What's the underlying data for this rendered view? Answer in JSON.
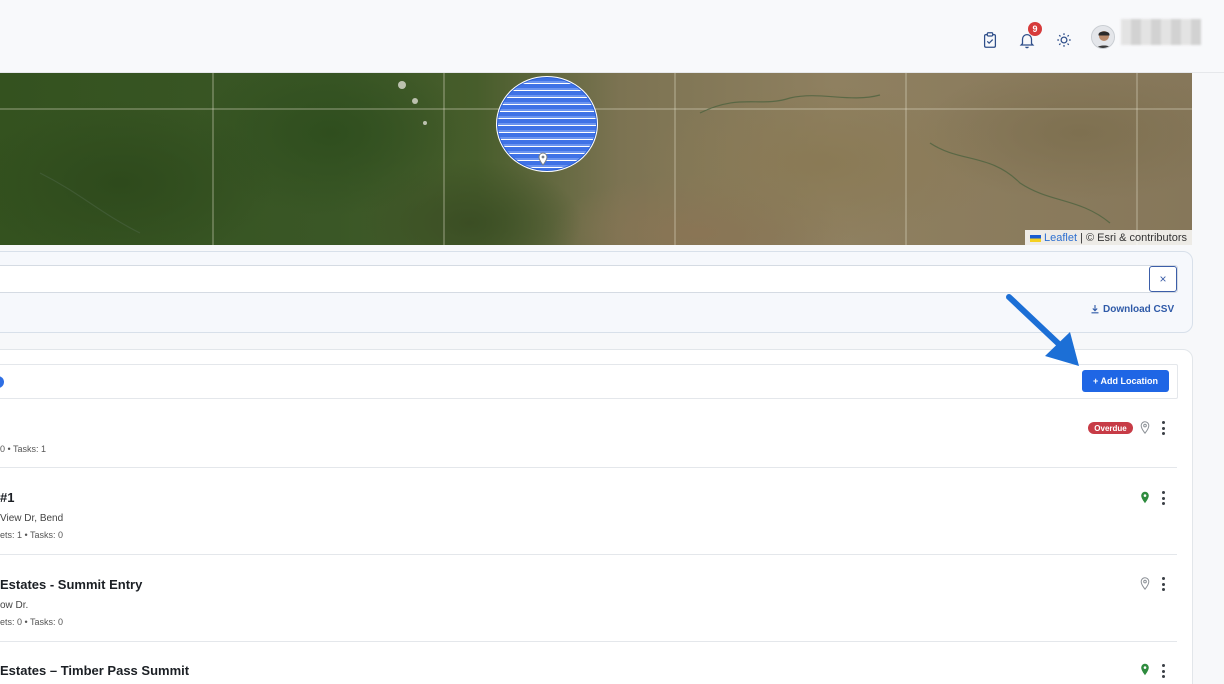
{
  "header": {
    "notification_count": "9",
    "icons": [
      "clipboard-check-icon",
      "bell-icon",
      "sun-icon"
    ]
  },
  "map": {
    "attribution_link": "Leaflet",
    "attribution_text": "| © Esri & contributors"
  },
  "filters": {
    "search_value": "",
    "clear_label": "×",
    "download_label": "Download CSV"
  },
  "locations": {
    "add_button_label": "+ Add Location",
    "rows": [
      {
        "title": "",
        "address": "",
        "meta": "0 • Tasks: 1",
        "status": "Overdue",
        "pin_color": "#8a8f95"
      },
      {
        "title": "#1",
        "address": "View Dr, Bend",
        "meta": "ets: 1 • Tasks: 0",
        "status": "",
        "pin_color": "#2e8b3e"
      },
      {
        "title": "Estates - Summit Entry",
        "address": "ow Dr.",
        "meta": "ets: 0 • Tasks: 0",
        "status": "",
        "pin_color": "#8a8f95"
      },
      {
        "title": "Estates – Timber Pass Summit",
        "address": "",
        "meta": "",
        "status": "",
        "pin_color": "#2e8b3e"
      }
    ]
  },
  "colors": {
    "primary": "#1f66e5",
    "overdue": "#c73b46",
    "annotation_arrow": "#1c6fd6"
  }
}
